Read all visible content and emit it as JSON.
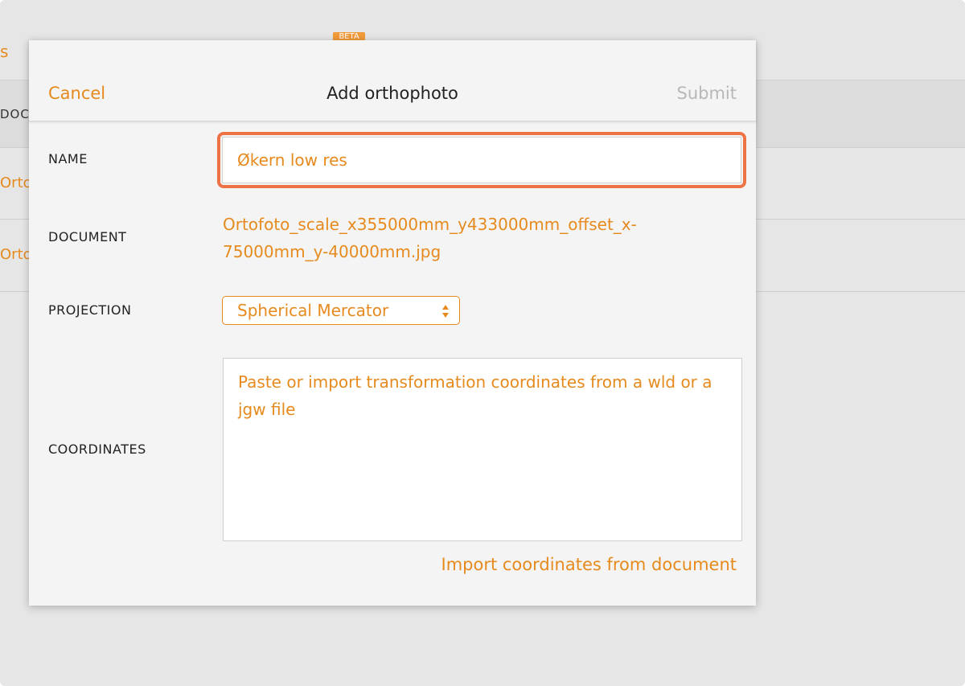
{
  "background": {
    "tab_text": "s",
    "beta_badge": "BETA",
    "column_document": "DOCU",
    "rows": [
      "Orto",
      "Orto"
    ]
  },
  "modal": {
    "cancel_label": "Cancel",
    "title": "Add orthophoto",
    "submit_label": "Submit",
    "name": {
      "label": "NAME",
      "value": "Økern low res"
    },
    "document": {
      "label": "DOCUMENT",
      "value": "Ortofoto_scale_x355000mm_y433000mm_offset_x-75000mm_y-40000mm.jpg"
    },
    "projection": {
      "label": "PROJECTION",
      "selected": "Spherical Mercator"
    },
    "coordinates": {
      "label": "COORDINATES",
      "placeholder": "Paste or import transformation coordinates from a wld or a jgw file",
      "value": ""
    },
    "import_label": "Import coordinates from document"
  },
  "colors": {
    "accent": "#e68a1e",
    "focus_ring": "#ee7344",
    "disabled": "#b8b8b8"
  }
}
